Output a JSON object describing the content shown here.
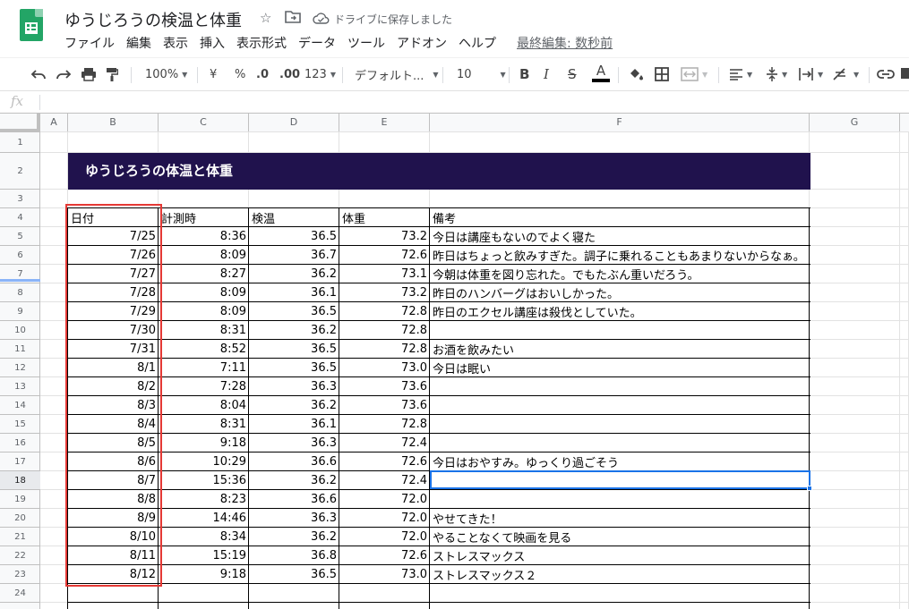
{
  "app": {
    "title": "ゆうじろうの検温と体重",
    "save_status": "ドライブに保存しました",
    "menu": [
      "ファイル",
      "編集",
      "表示",
      "挿入",
      "表示形式",
      "データ",
      "ツール",
      "アドオン",
      "ヘルプ"
    ],
    "last_edit": "最終編集: 数秒前"
  },
  "toolbar": {
    "zoom": "100%",
    "currency": "¥",
    "percent": "%",
    "decrease_decimal": ".0",
    "increase_decimal": ".00",
    "number_format": "123",
    "font": "デフォルト...",
    "font_size": "10",
    "bold": "B",
    "italic": "I",
    "strike": "S",
    "text_color": "A"
  },
  "formula_bar": {
    "fx": "fx",
    "value": ""
  },
  "grid": {
    "columns": [
      "A",
      "B",
      "C",
      "D",
      "E",
      "F",
      "G"
    ],
    "rows": [
      "1",
      "2",
      "3",
      "4",
      "5",
      "6",
      "7",
      "8",
      "9",
      "10",
      "11",
      "12",
      "13",
      "14",
      "15",
      "16",
      "17",
      "18",
      "19",
      "20",
      "21",
      "22",
      "23",
      "24"
    ],
    "active_row": "18",
    "banner": "ゆうじろうの体温と体重",
    "headers": [
      "日付",
      "計測時",
      "検温",
      "体重",
      "備考"
    ],
    "records": [
      [
        "7/25",
        "8:36",
        "36.5",
        "73.2",
        "今日は講座もないのでよく寝た"
      ],
      [
        "7/26",
        "8:09",
        "36.7",
        "72.6",
        "昨日はちょっと飲みすぎた。調子に乗れることもあまりないからなぁ。"
      ],
      [
        "7/27",
        "8:27",
        "36.2",
        "73.1",
        "今朝は体重を図り忘れた。でもたぶん重いだろう。"
      ],
      [
        "7/28",
        "8:09",
        "36.1",
        "73.2",
        "昨日のハンバーグはおいしかった。"
      ],
      [
        "7/29",
        "8:09",
        "36.5",
        "72.8",
        "昨日のエクセル講座は殺伐としていた。"
      ],
      [
        "7/30",
        "8:31",
        "36.2",
        "72.8",
        ""
      ],
      [
        "7/31",
        "8:52",
        "36.5",
        "72.8",
        "お酒を飲みたい"
      ],
      [
        "8/1",
        "7:11",
        "36.5",
        "73.0",
        "今日は眠い"
      ],
      [
        "8/2",
        "7:28",
        "36.3",
        "73.6",
        ""
      ],
      [
        "8/3",
        "8:04",
        "36.2",
        "73.6",
        ""
      ],
      [
        "8/4",
        "8:31",
        "36.1",
        "72.8",
        ""
      ],
      [
        "8/5",
        "9:18",
        "36.3",
        "72.4",
        ""
      ],
      [
        "8/6",
        "10:29",
        "36.6",
        "72.6",
        "今日はおやすみ。ゆっくり過ごそう"
      ],
      [
        "8/7",
        "15:36",
        "36.2",
        "72.4",
        ""
      ],
      [
        "8/8",
        "8:23",
        "36.6",
        "72.0",
        ""
      ],
      [
        "8/9",
        "14:46",
        "36.3",
        "72.0",
        "やせてきた！"
      ],
      [
        "8/10",
        "8:34",
        "36.2",
        "72.0",
        "やることなくて映画を見る"
      ],
      [
        "8/11",
        "15:19",
        "36.8",
        "72.6",
        "ストレスマックス"
      ],
      [
        "8/12",
        "9:18",
        "36.5",
        "73.0",
        "ストレスマックス２"
      ]
    ]
  }
}
